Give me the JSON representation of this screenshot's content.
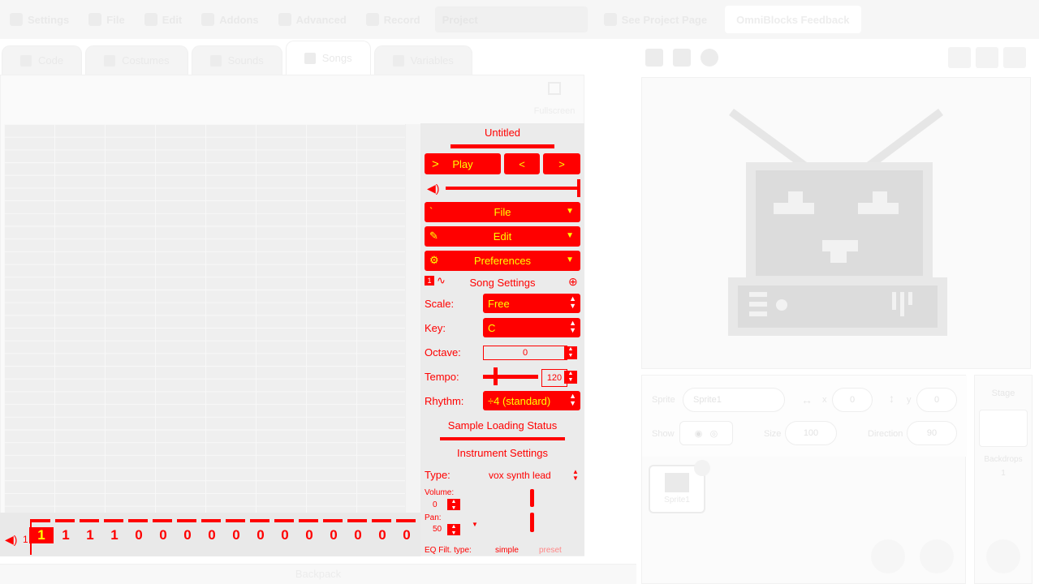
{
  "menu": {
    "settings": "Settings",
    "file": "File",
    "edit": "Edit",
    "addons": "Addons",
    "advanced": "Advanced",
    "record": "Record",
    "project_title": "Project",
    "see_project_page": "See Project Page",
    "feedback": "OmniBlocks Feedback"
  },
  "tabs": [
    "Code",
    "Costumes",
    "Sounds",
    "Songs",
    "Variables"
  ],
  "editor": {
    "fullscreen_label": "Fullscreen"
  },
  "song": {
    "title": "Untitled",
    "play_label": "Play",
    "prev_label": "<",
    "next_label": ">",
    "volume_percent": 100,
    "file_label": "File",
    "edit_label": "Edit",
    "preferences_label": "Preferences",
    "song_settings_label": "Song Settings",
    "channel_badge": "1",
    "scale_label": "Scale:",
    "scale_value": "Free",
    "key_label": "Key:",
    "key_value": "C",
    "octave_label": "Octave:",
    "octave_value": "0",
    "tempo_label": "Tempo:",
    "tempo_value": "120",
    "tempo_slider_fraction": 0.2,
    "rhythm_label": "Rhythm:",
    "rhythm_value": "÷4 (standard)",
    "sample_status_label": "Sample Loading Status",
    "instrument_settings_label": "Instrument Settings",
    "type_label": "Type:",
    "type_value": "vox synth lead",
    "volume_label": "Volume:",
    "volume_value": "0",
    "pan_label": "Pan:",
    "pan_value": "50",
    "eq_filt_label": "EQ Filt. type:",
    "eq_filt_value": "simple",
    "eq_filt_extra": "preset"
  },
  "pattern": {
    "channel_number": "1",
    "beats": [
      "1",
      "1",
      "1",
      "1",
      "0",
      "0",
      "0",
      "0",
      "0",
      "0",
      "0",
      "0",
      "0",
      "0",
      "0",
      "0"
    ]
  },
  "stage_pane": {
    "sprite_label": "Sprite",
    "sprite_name": "Sprite1",
    "x_label": "x",
    "x_value": "0",
    "y_label": "y",
    "y_value": "0",
    "show_label": "Show",
    "size_label": "Size",
    "size_value": "100",
    "direction_label": "Direction",
    "direction_value": "90",
    "sprite_thumb_label": "Sprite1",
    "stage_label": "Stage",
    "backdrops_label": "Backdrops",
    "backdrops_count": "1"
  },
  "backpack_label": "Backpack",
  "colors": {
    "accent": "#ff0000",
    "accent_text": "#ffff00"
  }
}
